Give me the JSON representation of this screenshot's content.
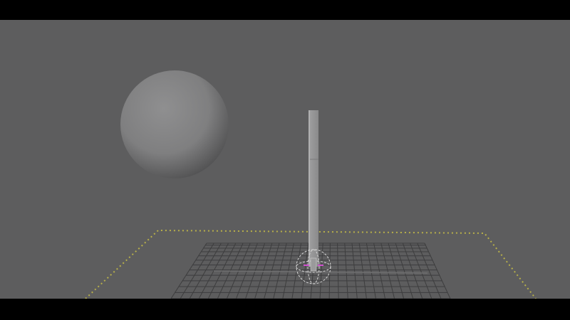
{
  "viewport": {
    "background_color": "#5d5d5e",
    "letterbox_color": "#000000"
  },
  "scene": {
    "objects": [
      {
        "name": "sphere",
        "type": "polygon-sphere",
        "color": "#8a8a8b"
      },
      {
        "name": "pole",
        "type": "polygon-cube",
        "color": "#9a9a9b"
      },
      {
        "name": "ground-grid",
        "type": "grid",
        "color": "#3e3e3f"
      },
      {
        "name": "resolution-gate",
        "type": "dotted-boundary",
        "color": "#b8b04a"
      },
      {
        "name": "manipulator",
        "type": "rotate-manipulator",
        "color": "#d8d8d8",
        "accent_color": "#d050d0"
      }
    ]
  }
}
